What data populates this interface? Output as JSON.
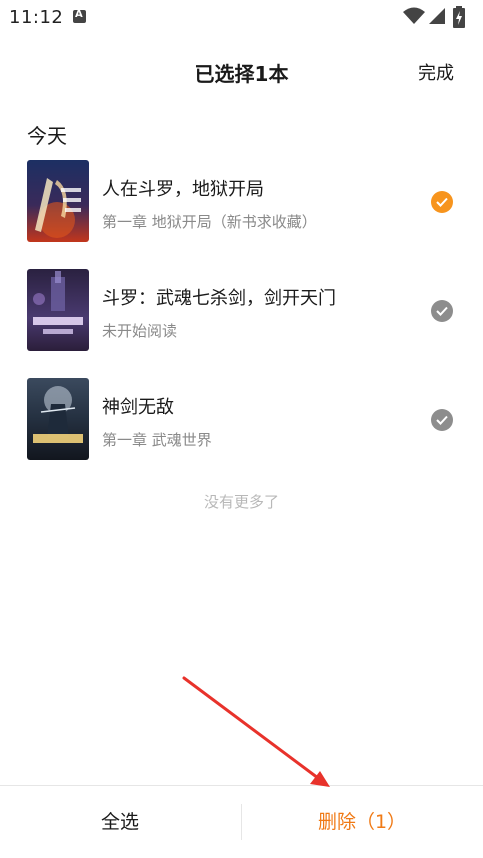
{
  "status_bar": {
    "time": "11:12",
    "notification_icon": "text-a-icon",
    "wifi_icon": "wifi-icon",
    "signal_icon": "cell-signal-icon",
    "battery_icon": "battery-charging-icon"
  },
  "header": {
    "title": "已选择1本",
    "done_label": "完成"
  },
  "section": {
    "title": "今天"
  },
  "books": [
    {
      "title": "人在斗罗，地狱开局",
      "subtitle": "第一章 地狱开局（新书求收藏）",
      "selected": true,
      "cover_text": "人在斗罗地狱开局"
    },
    {
      "title": "斗罗：武魂七杀剑，剑开天门",
      "subtitle": "未开始阅读",
      "selected": false,
      "cover_text": "武魂七杀剑"
    },
    {
      "title": "神剑无敌",
      "subtitle": "第一章 武魂世界",
      "selected": false,
      "cover_text": "神剑无敌"
    }
  ],
  "list_end": "没有更多了",
  "bottom_bar": {
    "select_all_label": "全选",
    "delete_label": "删除（1）"
  },
  "colors": {
    "accent": "#f7941d",
    "delete": "#f07a16",
    "unchecked": "#8d8d8d",
    "annotation_arrow": "#e8322b"
  }
}
